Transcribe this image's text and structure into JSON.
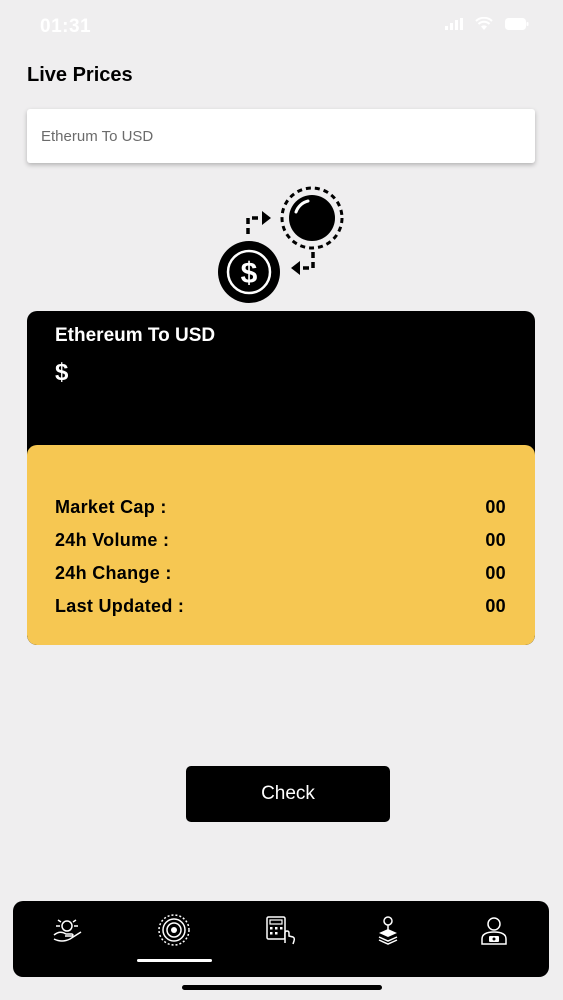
{
  "status": {
    "time": "01:31"
  },
  "page": {
    "title": "Live Prices"
  },
  "selector": {
    "value": "Etherum To USD"
  },
  "card": {
    "pair": "Ethereum To USD",
    "price": "$",
    "stats": [
      {
        "label": "Market Cap :",
        "value": "00"
      },
      {
        "label": "24h Volume :",
        "value": "00"
      },
      {
        "label": "24h Change :",
        "value": "00"
      },
      {
        "label": "Last Updated :",
        "value": "00"
      }
    ]
  },
  "actions": {
    "check_label": "Check"
  },
  "tabs": [
    {
      "icon": "money-hand-icon"
    },
    {
      "icon": "target-icon",
      "active": true
    },
    {
      "icon": "calculator-icon"
    },
    {
      "icon": "location-layers-icon"
    },
    {
      "icon": "user-profile-icon"
    }
  ],
  "colors": {
    "accent": "#f6c752",
    "card": "#000000",
    "background": "#efeeef"
  }
}
